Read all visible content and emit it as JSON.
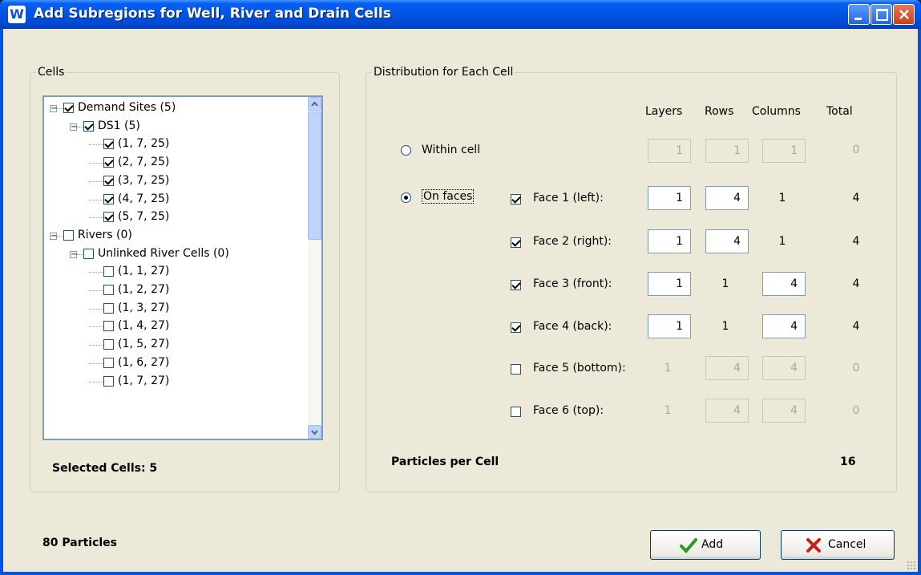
{
  "window": {
    "title": "Add Subregions for Well, River and Drain Cells",
    "icon_letter": "W"
  },
  "cells_group": {
    "legend": "Cells",
    "tree": [
      {
        "label": "Demand Sites (5)",
        "checked": true,
        "level": 0,
        "expander": "-"
      },
      {
        "label": "DS1 (5)",
        "checked": true,
        "level": 1,
        "expander": "-"
      },
      {
        "label": "(1, 7, 25)",
        "checked": true,
        "level": 2
      },
      {
        "label": "(2, 7, 25)",
        "checked": true,
        "level": 2
      },
      {
        "label": "(3, 7, 25)",
        "checked": true,
        "level": 2
      },
      {
        "label": "(4, 7, 25)",
        "checked": true,
        "level": 2
      },
      {
        "label": "(5, 7, 25)",
        "checked": true,
        "level": 2
      },
      {
        "label": "Rivers (0)",
        "checked": false,
        "level": 0,
        "expander": "-"
      },
      {
        "label": "Unlinked River Cells (0)",
        "checked": false,
        "level": 1,
        "expander": "-"
      },
      {
        "label": "(1, 1, 27)",
        "checked": false,
        "level": 2
      },
      {
        "label": "(1, 2, 27)",
        "checked": false,
        "level": 2
      },
      {
        "label": "(1, 3, 27)",
        "checked": false,
        "level": 2
      },
      {
        "label": "(1, 4, 27)",
        "checked": false,
        "level": 2
      },
      {
        "label": "(1, 5, 27)",
        "checked": false,
        "level": 2
      },
      {
        "label": "(1, 6, 27)",
        "checked": false,
        "level": 2
      },
      {
        "label": "(1, 7, 27)",
        "checked": false,
        "level": 2
      }
    ],
    "selected_cells": "Selected Cells: 5"
  },
  "distribution_group": {
    "legend": "Distribution for Each Cell",
    "headers": {
      "layers": "Layers",
      "rows": "Rows",
      "columns": "Columns",
      "total": "Total"
    },
    "within_cell": {
      "label": "Within cell",
      "selected": false,
      "layers": "1",
      "rows": "1",
      "columns": "1",
      "total": "0"
    },
    "on_faces": {
      "label": "On faces",
      "selected": true
    },
    "faces": [
      {
        "label": "Face 1 (left):",
        "checked": true,
        "layers": "1",
        "rows": "4",
        "columns": "1",
        "total": "4"
      },
      {
        "label": "Face 2 (right):",
        "checked": true,
        "layers": "1",
        "rows": "4",
        "columns": "1",
        "total": "4"
      },
      {
        "label": "Face 3 (front):",
        "checked": true,
        "layers": "1",
        "rows": "1",
        "columns": "4",
        "total": "4"
      },
      {
        "label": "Face 4 (back):",
        "checked": true,
        "layers": "1",
        "rows": "1",
        "columns": "4",
        "total": "4"
      },
      {
        "label": "Face 5 (bottom):",
        "checked": false,
        "layers": "1",
        "rows": "4",
        "columns": "4",
        "total": "0"
      },
      {
        "label": "Face 6 (top):",
        "checked": false,
        "layers": "1",
        "rows": "4",
        "columns": "4",
        "total": "0"
      }
    ],
    "particles_per_cell_label": "Particles per Cell",
    "particles_per_cell_value": "16"
  },
  "footer": {
    "total_particles": "80 Particles",
    "add_label": "Add",
    "cancel_label": "Cancel"
  }
}
